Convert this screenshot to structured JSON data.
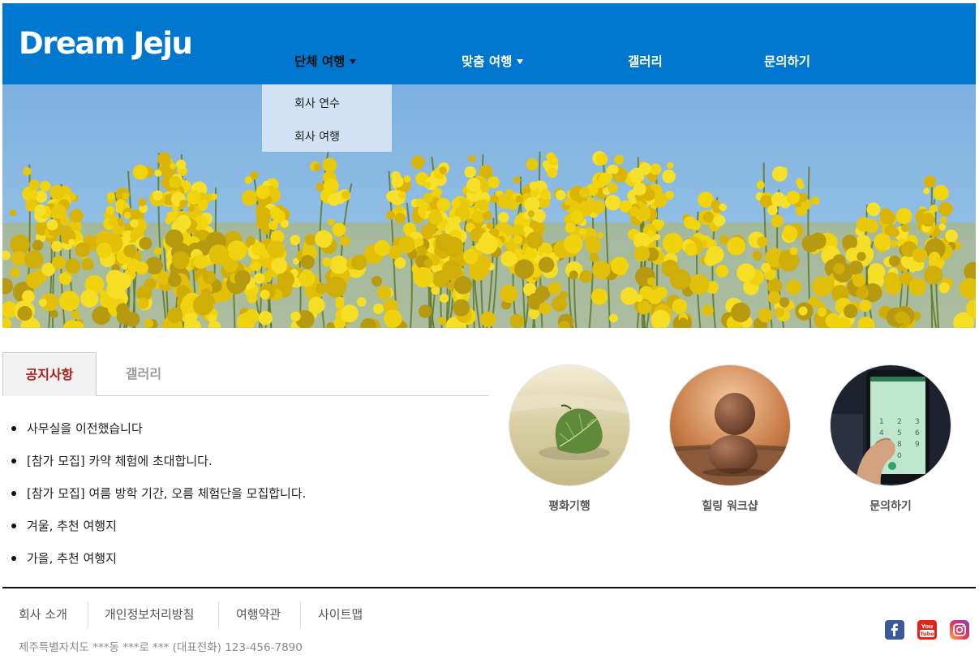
{
  "header": {
    "logo": "Dream Jeju",
    "nav": [
      {
        "label": "단체 여행",
        "has_caret": true
      },
      {
        "label": "맞춤 여행",
        "has_caret": true
      },
      {
        "label": "갤러리",
        "has_caret": false
      },
      {
        "label": "문의하기",
        "has_caret": false
      }
    ],
    "dropdown": [
      "회사 연수",
      "회사 여행"
    ],
    "brand_color": "#0077cf"
  },
  "tabs": [
    {
      "label": "공지사항",
      "active": true
    },
    {
      "label": "갤러리",
      "active": false
    }
  ],
  "notices": [
    "사무실을 이전했습니다",
    "[참가 모집] 카약 체험에 초대합니다.",
    "[참가 모집] 여름 방학 기간, 오름 체험단을 모집합니다.",
    "겨울, 추천 여행지",
    "가을, 추천 여행지"
  ],
  "quick_links": [
    {
      "label": "평화기행",
      "icon": "leaf-on-sand-photo"
    },
    {
      "label": "힐링 워크샵",
      "icon": "stacked-stones-photo"
    },
    {
      "label": "문의하기",
      "icon": "phone-dialpad-photo"
    }
  ],
  "footer": {
    "links": [
      "회사 소개",
      "개인정보처리방침",
      "여행약관",
      "사이트맵"
    ],
    "address": "제주특별자치도 ***동 ***로 *** (대표전화) 123-456-7890",
    "social": [
      {
        "name": "facebook-icon",
        "color": "#3b5998"
      },
      {
        "name": "youtube-icon",
        "color": "#e62117"
      },
      {
        "name": "instagram-icon",
        "color": "#d6249f"
      }
    ]
  }
}
